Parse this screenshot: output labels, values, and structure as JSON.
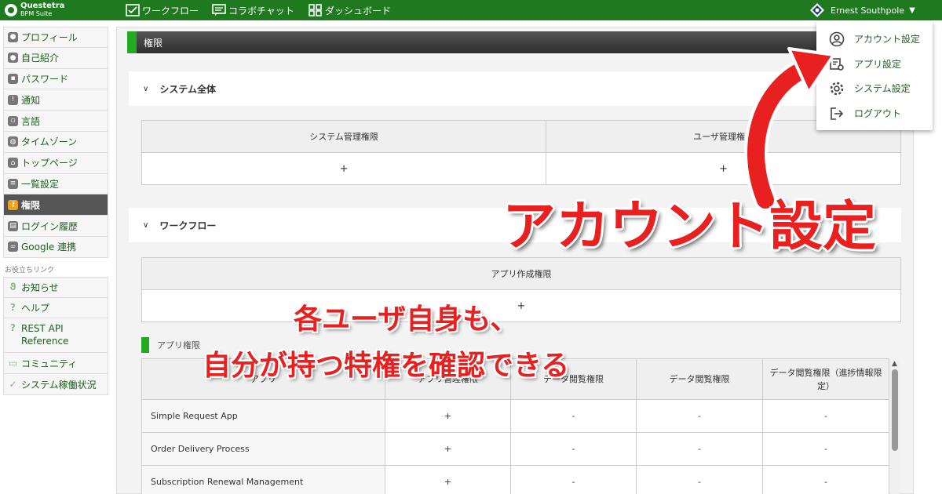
{
  "brand": {
    "name": "Questetra",
    "sub": "BPM Suite"
  },
  "topnav": {
    "workflow": "ワークフロー",
    "chat": "コラボチャット",
    "dashboard": "ダッシュボード"
  },
  "user": {
    "name": "Ernest Southpole"
  },
  "sidebar": {
    "items": [
      {
        "label": "プロフィール"
      },
      {
        "label": "自己紹介"
      },
      {
        "label": "パスワード"
      },
      {
        "label": "通知"
      },
      {
        "label": "言語"
      },
      {
        "label": "タイムゾーン"
      },
      {
        "label": "トップページ"
      },
      {
        "label": "一覧設定"
      },
      {
        "label": "権限"
      },
      {
        "label": "ログイン履歴"
      },
      {
        "label": "Google 連携"
      }
    ],
    "links_heading": "お役立ちリンク",
    "links": [
      {
        "label": "お知らせ"
      },
      {
        "label": "ヘルプ"
      },
      {
        "label": "REST API Reference"
      },
      {
        "label": "コミュニティ"
      },
      {
        "label": "システム稼働状況"
      }
    ]
  },
  "page": {
    "title": "権限",
    "system_section": "システム全体",
    "system_table": {
      "headers": [
        "システム管理権限",
        "ユーザ管理権限"
      ],
      "values": [
        "+",
        "+"
      ]
    },
    "workflow_section": "ワークフロー",
    "app_create_table": {
      "header": "アプリ作成権限",
      "value": "+"
    },
    "app_perm_label": "アプリ権限",
    "app_table": {
      "headers": [
        "アプリ",
        "アプリ管理権限",
        "データ閲覧権限",
        "データ閲覧権限",
        "データ閲覧権限（進捗情報限定）"
      ],
      "rows": [
        {
          "name": "Simple Request App",
          "cells": [
            "+",
            "-",
            "-",
            "-"
          ]
        },
        {
          "name": "Order Delivery Process",
          "cells": [
            "+",
            "-",
            "-",
            "-"
          ]
        },
        {
          "name": "Subscription Renewal Management",
          "cells": [
            "+",
            "-",
            "-",
            "-"
          ]
        }
      ]
    }
  },
  "dropdown": {
    "items": [
      {
        "label": "アカウント設定",
        "icon": "account-circle-icon"
      },
      {
        "label": "アプリ設定",
        "icon": "app-settings-icon"
      },
      {
        "label": "システム設定",
        "icon": "gear-icon"
      },
      {
        "label": "ログアウト",
        "icon": "logout-icon"
      }
    ]
  },
  "annotations": {
    "big": "アカウント設定",
    "line1": "各ユーザ自身も、",
    "line2": "自分が持つ特権を確認できる"
  },
  "colors": {
    "topbar": "#1f7a1f",
    "accent_green": "#22aa22",
    "annotation_red": "#e82020"
  }
}
